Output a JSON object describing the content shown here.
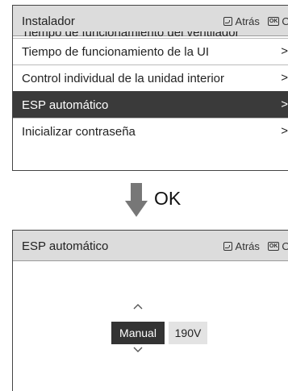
{
  "installer_screen": {
    "title": "Instalador",
    "back_label": "Atrás",
    "ok_badge": "OK",
    "ok_label": "Ok",
    "partial_item": "Tiempo de funcionamiento del ventilador",
    "items": [
      {
        "label": "Tiempo de funcionamiento de la UI",
        "chevron": ">"
      },
      {
        "label": "Control individual de la unidad interior",
        "chevron": ">"
      },
      {
        "label": "ESP automático",
        "chevron": ">",
        "selected": true
      },
      {
        "label": "Inicializar contraseña",
        "chevron": ">"
      }
    ]
  },
  "transition": {
    "label": "OK",
    "icon": "down-arrow-icon"
  },
  "esp_screen": {
    "title": "ESP automático",
    "back_label": "Atrás",
    "ok_badge": "OK",
    "ok_label": "Ok",
    "mode_value": "Manual",
    "voltage_value": "190V",
    "up_caret": "^",
    "down_caret": "v"
  },
  "colors": {
    "header_bg": "#dcdcdc",
    "selected_bg": "#3a3a3a",
    "arrow": "#777777"
  }
}
